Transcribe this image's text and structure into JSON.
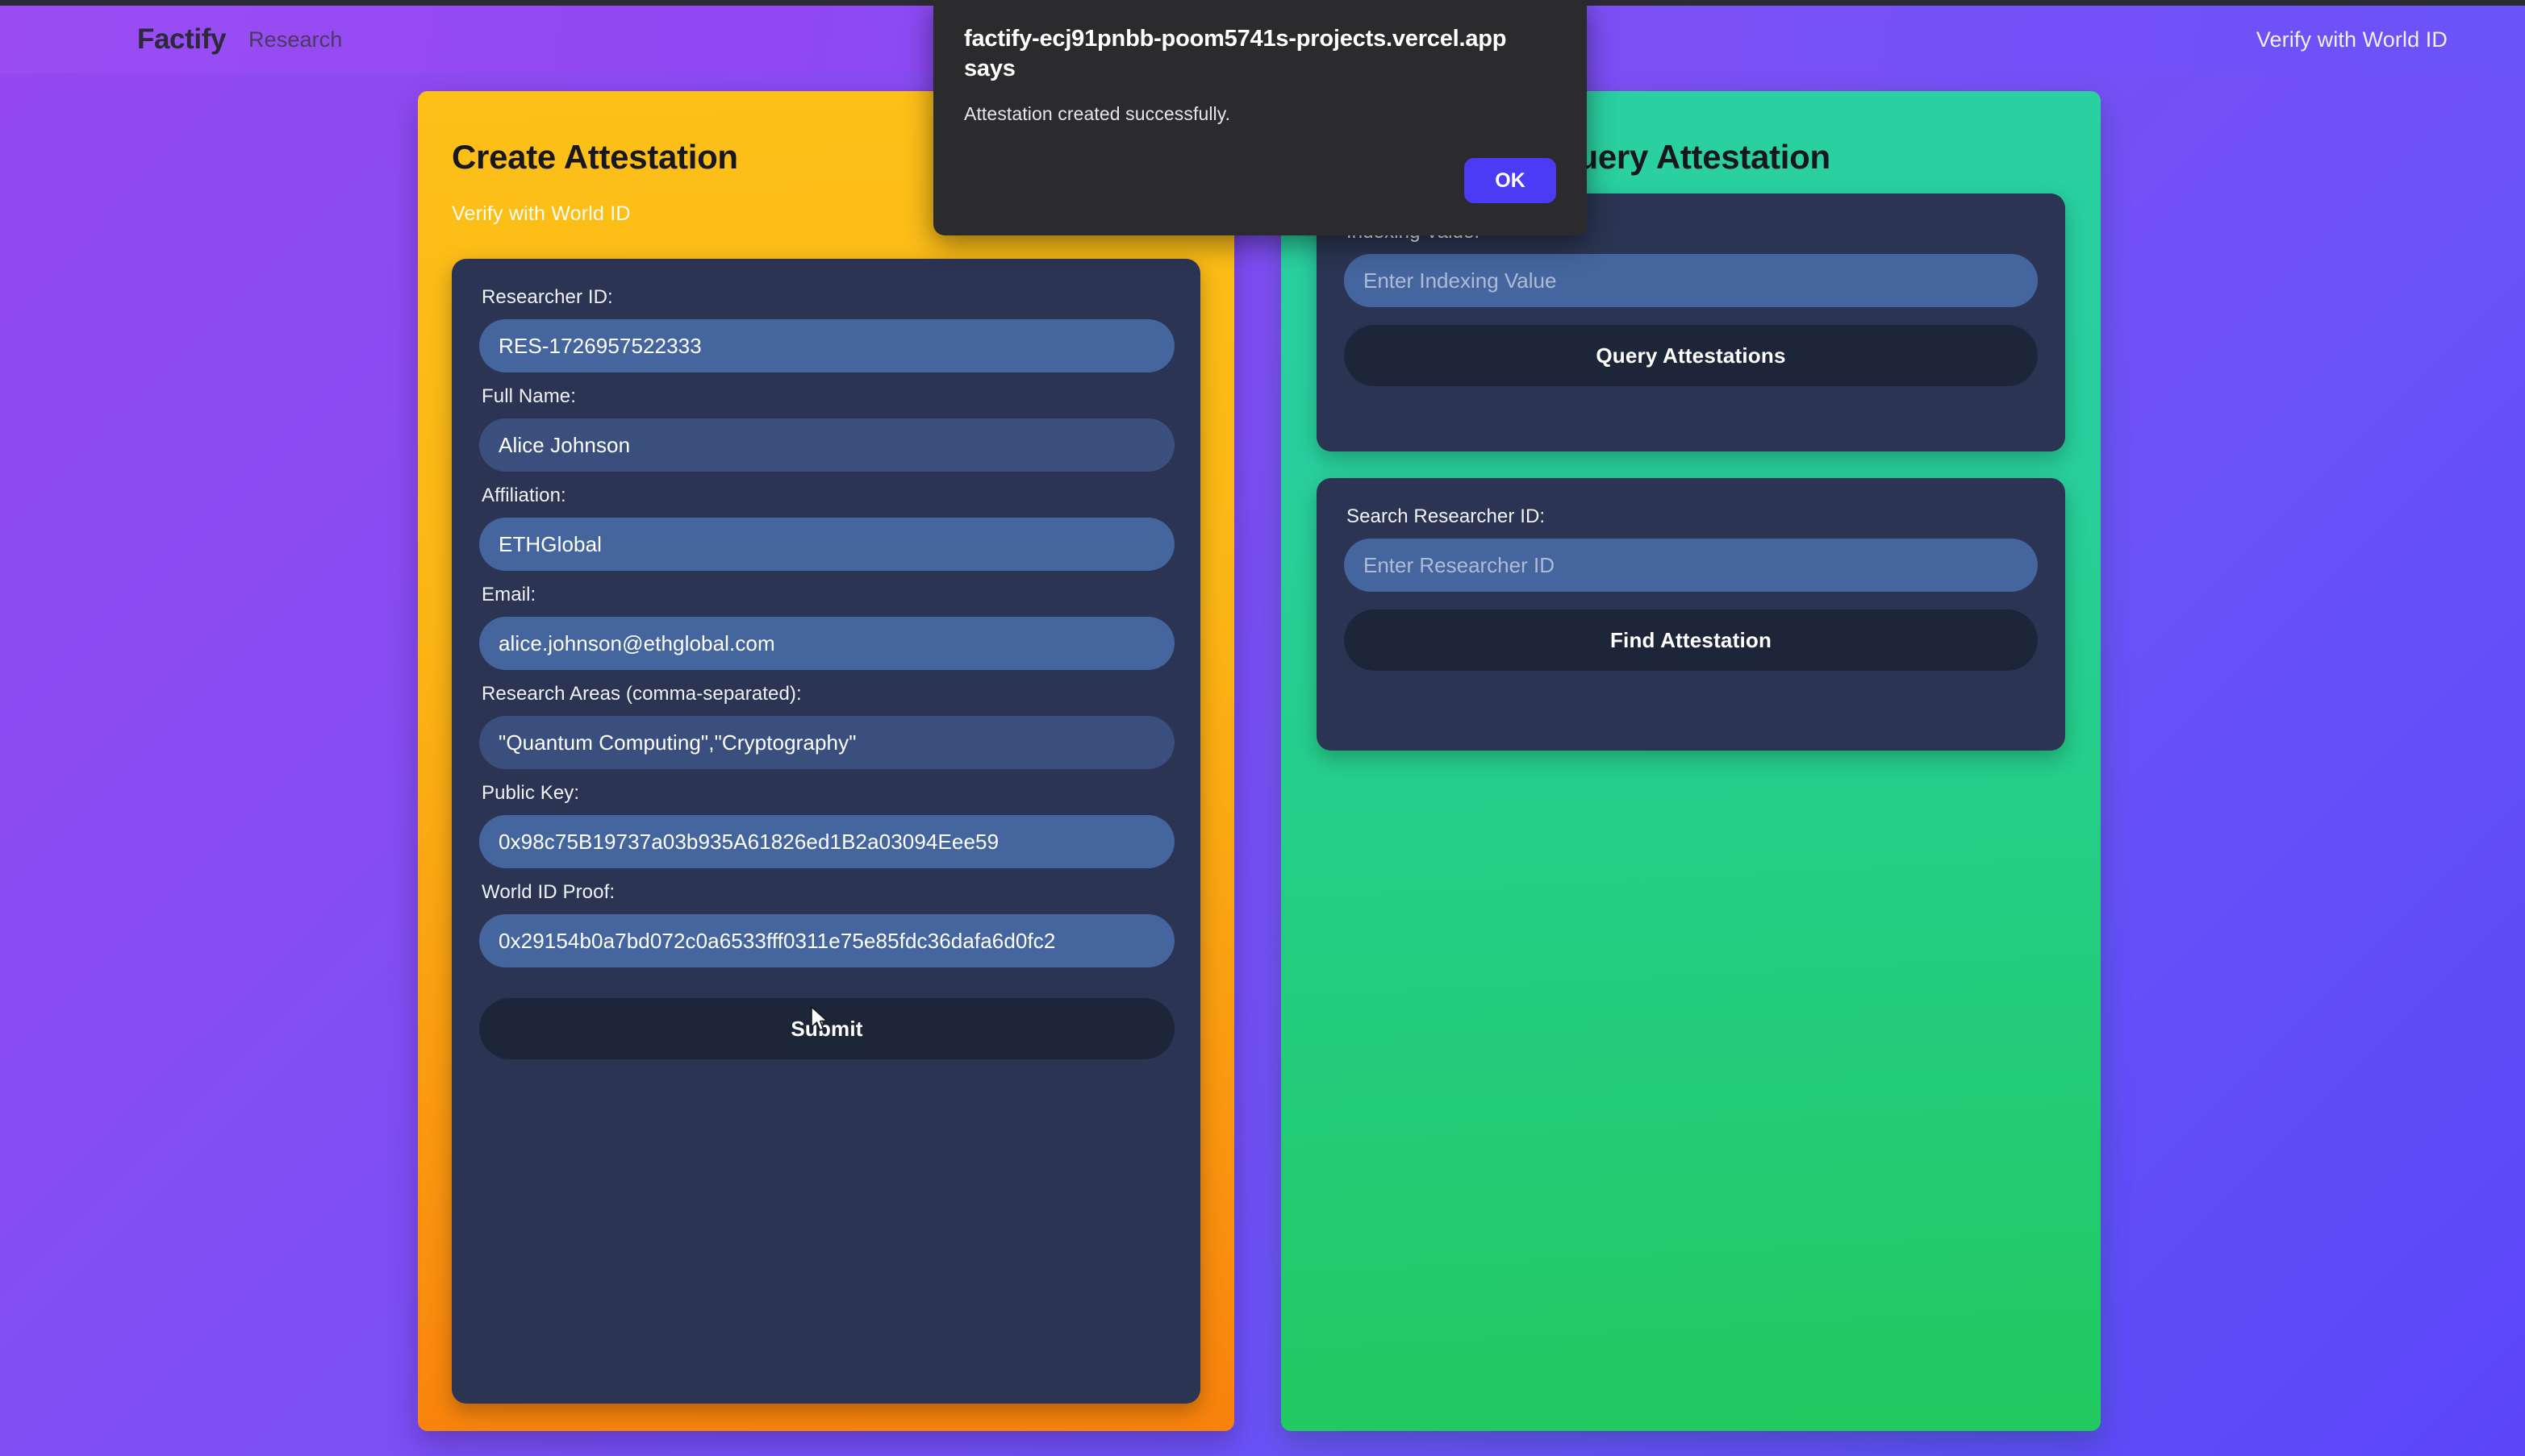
{
  "navbar": {
    "brand": "Factify",
    "research_link": "Research",
    "worldid_link": "Verify with World ID"
  },
  "create_panel": {
    "title": "Create Attestation",
    "subtitle": "Verify with World ID",
    "submit_label": "Submit",
    "fields": [
      {
        "label": "Researcher ID:",
        "value": "RES-1726957522333"
      },
      {
        "label": "Full Name:",
        "value": "Alice Johnson"
      },
      {
        "label": "Affiliation:",
        "value": "ETHGlobal"
      },
      {
        "label": "Email:",
        "value": "alice.johnson@ethglobal.com"
      },
      {
        "label": "Research Areas (comma-separated):",
        "value": "\"Quantum Computing\",\"Cryptography\""
      },
      {
        "label": "Public Key:",
        "value": "0x98c75B19737a03b935A61826ed1B2a03094Eee59"
      },
      {
        "label": "World ID Proof:",
        "value": "0x29154b0a7bd072c0a6533fff0311e75e85fdc36dafa6d0fc2"
      }
    ]
  },
  "query_panel": {
    "title": "Query Attestation",
    "cards": [
      {
        "label": "Indexing Value:",
        "placeholder": "Enter Indexing Value",
        "value": "",
        "button_label": "Query Attestations"
      },
      {
        "label": "Search Researcher ID:",
        "placeholder": "Enter Researcher ID",
        "value": "",
        "button_label": "Find Attestation"
      }
    ]
  },
  "dialog": {
    "title": "factify-ecj91pnbb-poom5741s-projects.vercel.app says",
    "message": "Attestation created successfully.",
    "ok_label": "OK"
  },
  "colors": {
    "brand_purple": "#8b4cf2",
    "create_panel_orange": "#fbb615",
    "query_panel_green": "#26ce8d",
    "card_navy": "#2b3553",
    "input_blue": "#44659e",
    "button_dark": "#1d2539",
    "dialog_accent": "#4b3bf5"
  }
}
